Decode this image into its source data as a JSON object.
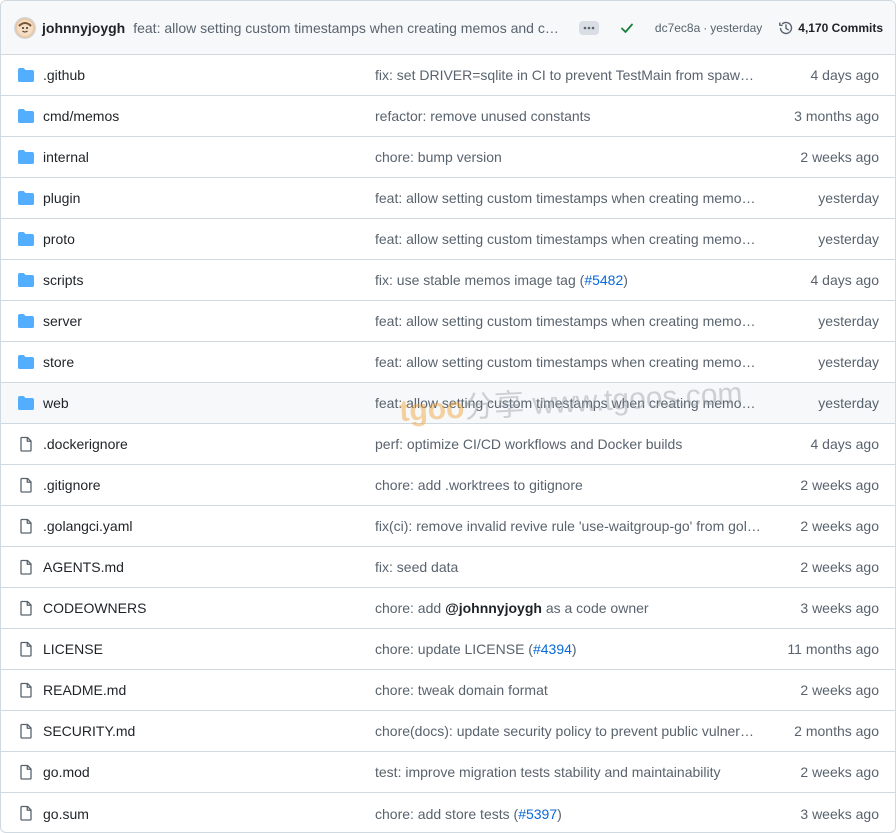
{
  "header": {
    "author": "johnnyjoygh",
    "message": "feat: allow setting custom timestamps when creating memos and comments",
    "sha": "dc7ec8a",
    "sep": "·",
    "time": "yesterday",
    "commits_label": "4,170 Commits"
  },
  "colors": {
    "folder": "#54aeff",
    "file": "#59636e",
    "success": "#1a7f37",
    "link": "#0969da"
  },
  "rows": [
    {
      "type": "dir",
      "name": ".github",
      "msg": [
        {
          "t": "fix: set DRIVER=sqlite in CI to prevent TestMain from spawning containers"
        }
      ],
      "time": "4 days ago"
    },
    {
      "type": "dir",
      "name": "cmd/memos",
      "msg": [
        {
          "t": "refactor: remove unused constants"
        }
      ],
      "time": "3 months ago"
    },
    {
      "type": "dir",
      "name": "internal",
      "msg": [
        {
          "t": "chore: bump version"
        }
      ],
      "time": "2 weeks ago"
    },
    {
      "type": "dir",
      "name": "plugin",
      "msg": [
        {
          "t": "feat: allow setting custom timestamps when creating memos and comments"
        }
      ],
      "time": "yesterday"
    },
    {
      "type": "dir",
      "name": "proto",
      "msg": [
        {
          "t": "feat: allow setting custom timestamps when creating memos and comments"
        }
      ],
      "time": "yesterday"
    },
    {
      "type": "dir",
      "name": "scripts",
      "msg": [
        {
          "t": "fix: use stable memos image tag ("
        },
        {
          "t": "#5482",
          "c": "link"
        },
        {
          "t": ")"
        }
      ],
      "time": "4 days ago"
    },
    {
      "type": "dir",
      "name": "server",
      "msg": [
        {
          "t": "feat: allow setting custom timestamps when creating memos and comments"
        }
      ],
      "time": "yesterday"
    },
    {
      "type": "dir",
      "name": "store",
      "msg": [
        {
          "t": "feat: allow setting custom timestamps when creating memos and comments"
        }
      ],
      "time": "yesterday"
    },
    {
      "type": "dir",
      "name": "web",
      "msg": [
        {
          "t": "feat: allow setting custom timestamps when creating memos and comments"
        }
      ],
      "time": "yesterday",
      "hover": true
    },
    {
      "type": "file",
      "name": ".dockerignore",
      "msg": [
        {
          "t": "perf: optimize CI/CD workflows and Docker builds"
        }
      ],
      "time": "4 days ago"
    },
    {
      "type": "file",
      "name": ".gitignore",
      "msg": [
        {
          "t": "chore: add .worktrees to gitignore"
        }
      ],
      "time": "2 weeks ago"
    },
    {
      "type": "file",
      "name": ".golangci.yaml",
      "msg": [
        {
          "t": "fix(ci): remove invalid revive rule 'use-waitgroup-go' from golangci config"
        }
      ],
      "time": "2 weeks ago"
    },
    {
      "type": "file",
      "name": "AGENTS.md",
      "msg": [
        {
          "t": "fix: seed data"
        }
      ],
      "time": "2 weeks ago"
    },
    {
      "type": "file",
      "name": "CODEOWNERS",
      "msg": [
        {
          "t": "chore: add "
        },
        {
          "t": "@johnnyjoygh",
          "c": "mention"
        },
        {
          "t": " as a code owner"
        }
      ],
      "time": "3 weeks ago"
    },
    {
      "type": "file",
      "name": "LICENSE",
      "msg": [
        {
          "t": "chore: update LICENSE ("
        },
        {
          "t": "#4394",
          "c": "link"
        },
        {
          "t": ")"
        }
      ],
      "time": "11 months ago"
    },
    {
      "type": "file",
      "name": "README.md",
      "msg": [
        {
          "t": "chore: tweak domain format"
        }
      ],
      "time": "2 weeks ago"
    },
    {
      "type": "file",
      "name": "SECURITY.md",
      "msg": [
        {
          "t": "chore(docs): update security policy to prevent public vulnerability disclosure"
        }
      ],
      "time": "2 months ago"
    },
    {
      "type": "file",
      "name": "go.mod",
      "msg": [
        {
          "t": "test: improve migration tests stability and maintainability"
        }
      ],
      "time": "2 weeks ago"
    },
    {
      "type": "file",
      "name": "go.sum",
      "msg": [
        {
          "t": "chore: add store tests ("
        },
        {
          "t": "#5397",
          "c": "link"
        },
        {
          "t": ")"
        }
      ],
      "time": "3 weeks ago"
    }
  ],
  "watermark": {
    "a": "tgoo",
    "b": "分享 www.tgoos.com"
  }
}
